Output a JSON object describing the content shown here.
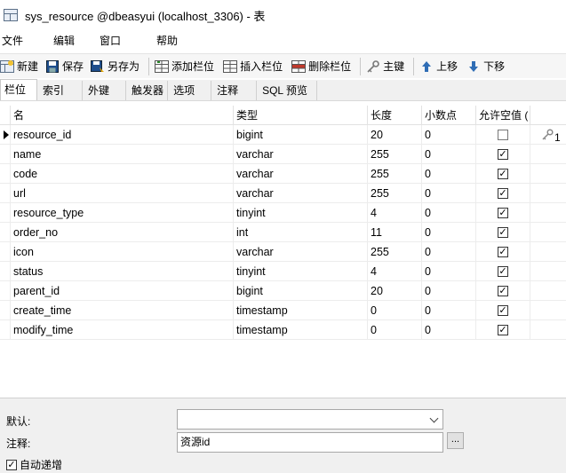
{
  "window": {
    "title": "sys_resource @dbeasyui (localhost_3306) - 表"
  },
  "menu": [
    "文件",
    "编辑",
    "窗口",
    "帮助"
  ],
  "toolbar": {
    "new": "新建",
    "save": "保存",
    "save_as": "另存为",
    "add_column": "添加栏位",
    "insert_column": "插入栏位",
    "delete_column": "删除栏位",
    "primary_key": "主键",
    "move_up": "上移",
    "move_down": "下移"
  },
  "tabs": [
    "栏位",
    "索引",
    "外键",
    "触发器",
    "选项",
    "注释",
    "SQL 预览"
  ],
  "columns_header": [
    "名",
    "类型",
    "长度",
    "小数点",
    "允许空值 ("
  ],
  "rows": [
    {
      "name": "resource_id",
      "type": "bigint",
      "length": "20",
      "decimals": "0",
      "nullable": false,
      "key": "1"
    },
    {
      "name": "name",
      "type": "varchar",
      "length": "255",
      "decimals": "0",
      "nullable": true,
      "key": ""
    },
    {
      "name": "code",
      "type": "varchar",
      "length": "255",
      "decimals": "0",
      "nullable": true,
      "key": ""
    },
    {
      "name": "url",
      "type": "varchar",
      "length": "255",
      "decimals": "0",
      "nullable": true,
      "key": ""
    },
    {
      "name": "resource_type",
      "type": "tinyint",
      "length": "4",
      "decimals": "0",
      "nullable": true,
      "key": ""
    },
    {
      "name": "order_no",
      "type": "int",
      "length": "11",
      "decimals": "0",
      "nullable": true,
      "key": ""
    },
    {
      "name": "icon",
      "type": "varchar",
      "length": "255",
      "decimals": "0",
      "nullable": true,
      "key": ""
    },
    {
      "name": "status",
      "type": "tinyint",
      "length": "4",
      "decimals": "0",
      "nullable": true,
      "key": ""
    },
    {
      "name": "parent_id",
      "type": "bigint",
      "length": "20",
      "decimals": "0",
      "nullable": true,
      "key": ""
    },
    {
      "name": "create_time",
      "type": "timestamp",
      "length": "0",
      "decimals": "0",
      "nullable": true,
      "key": ""
    },
    {
      "name": "modify_time",
      "type": "timestamp",
      "length": "0",
      "decimals": "0",
      "nullable": true,
      "key": ""
    }
  ],
  "properties": {
    "default_label": "默认:",
    "default_value": "",
    "comment_label": "注释:",
    "comment_value": "资源id",
    "ellipsis": "...",
    "auto_increment_label": "自动递增",
    "auto_increment_checked": true
  },
  "icons": {
    "app": "table-icon",
    "new": "new-table-icon",
    "save": "floppy-disk-icon",
    "save_as": "save-as-icon",
    "add_column": "add-column-icon",
    "insert_column": "insert-column-icon",
    "delete_column": "delete-column-icon",
    "primary_key": "key-icon",
    "move_up": "arrow-up-icon",
    "move_down": "arrow-down-icon"
  },
  "colors": {
    "arrow_blue": "#2f6db5",
    "delete_red": "#c0392b",
    "save_blue": "#1f4e8c"
  }
}
